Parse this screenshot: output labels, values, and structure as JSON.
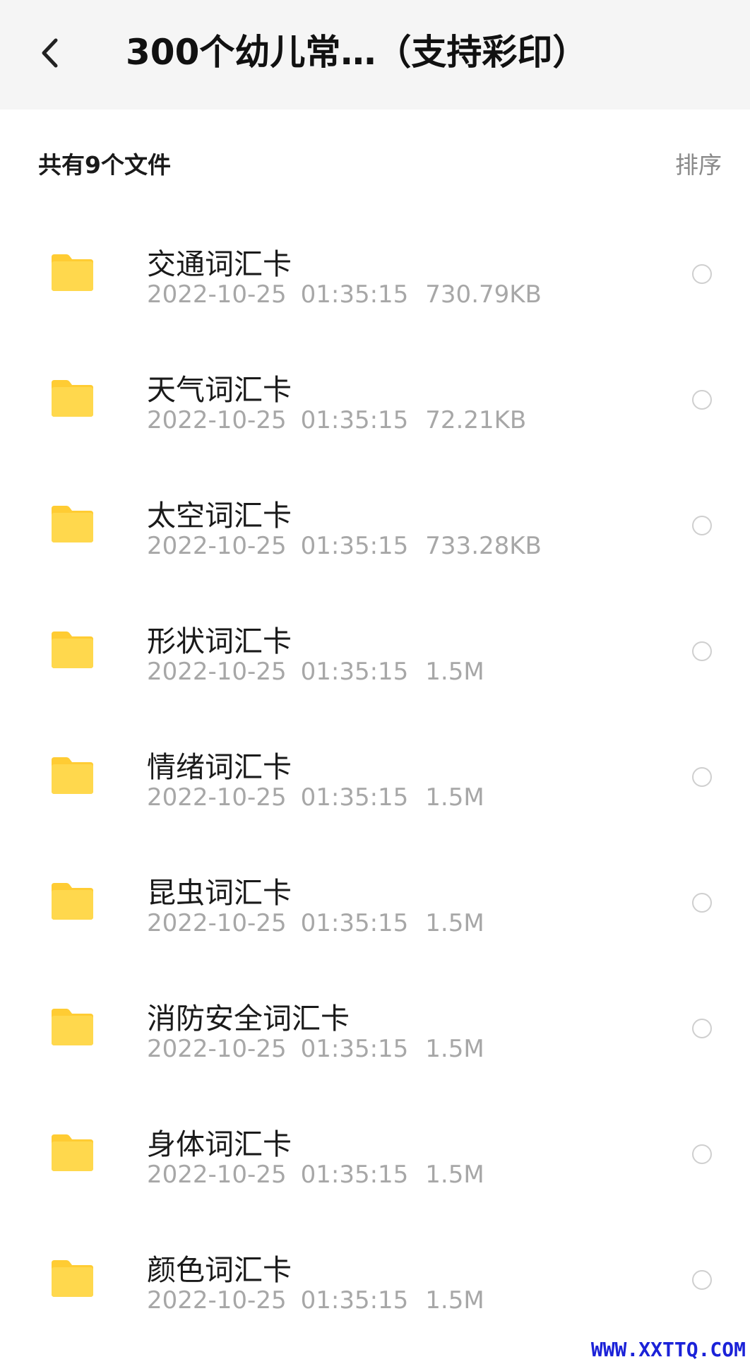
{
  "header": {
    "title": "300个幼儿常…（支持彩印）",
    "back_icon": "chevron-left-icon"
  },
  "summary": {
    "count_label": "共有9个文件",
    "sort_label": "排序"
  },
  "colors": {
    "folder": "#FFD84D",
    "folder_tab": "#FFCC33",
    "meta_text": "#A7A7A7",
    "header_bg": "#F5F5F5",
    "watermark": "#1B22D8"
  },
  "files": [
    {
      "name": "交通词汇卡",
      "date": "2022-10-25",
      "time": "01:35:15",
      "size": "730.79KB",
      "icon": "folder-icon"
    },
    {
      "name": "天气词汇卡",
      "date": "2022-10-25",
      "time": "01:35:15",
      "size": "72.21KB",
      "icon": "folder-icon"
    },
    {
      "name": "太空词汇卡",
      "date": "2022-10-25",
      "time": "01:35:15",
      "size": "733.28KB",
      "icon": "folder-icon"
    },
    {
      "name": "形状词汇卡",
      "date": "2022-10-25",
      "time": "01:35:15",
      "size": "1.5M",
      "icon": "folder-icon"
    },
    {
      "name": "情绪词汇卡",
      "date": "2022-10-25",
      "time": "01:35:15",
      "size": "1.5M",
      "icon": "folder-icon"
    },
    {
      "name": "昆虫词汇卡",
      "date": "2022-10-25",
      "time": "01:35:15",
      "size": "1.5M",
      "icon": "folder-icon"
    },
    {
      "name": "消防安全词汇卡",
      "date": "2022-10-25",
      "time": "01:35:15",
      "size": "1.5M",
      "icon": "folder-icon"
    },
    {
      "name": "身体词汇卡",
      "date": "2022-10-25",
      "time": "01:35:15",
      "size": "1.5M",
      "icon": "folder-icon"
    },
    {
      "name": "颜色词汇卡",
      "date": "2022-10-25",
      "time": "01:35:15",
      "size": "1.5M",
      "icon": "folder-icon"
    }
  ],
  "watermark": "WWW.XXTTQ.COM"
}
